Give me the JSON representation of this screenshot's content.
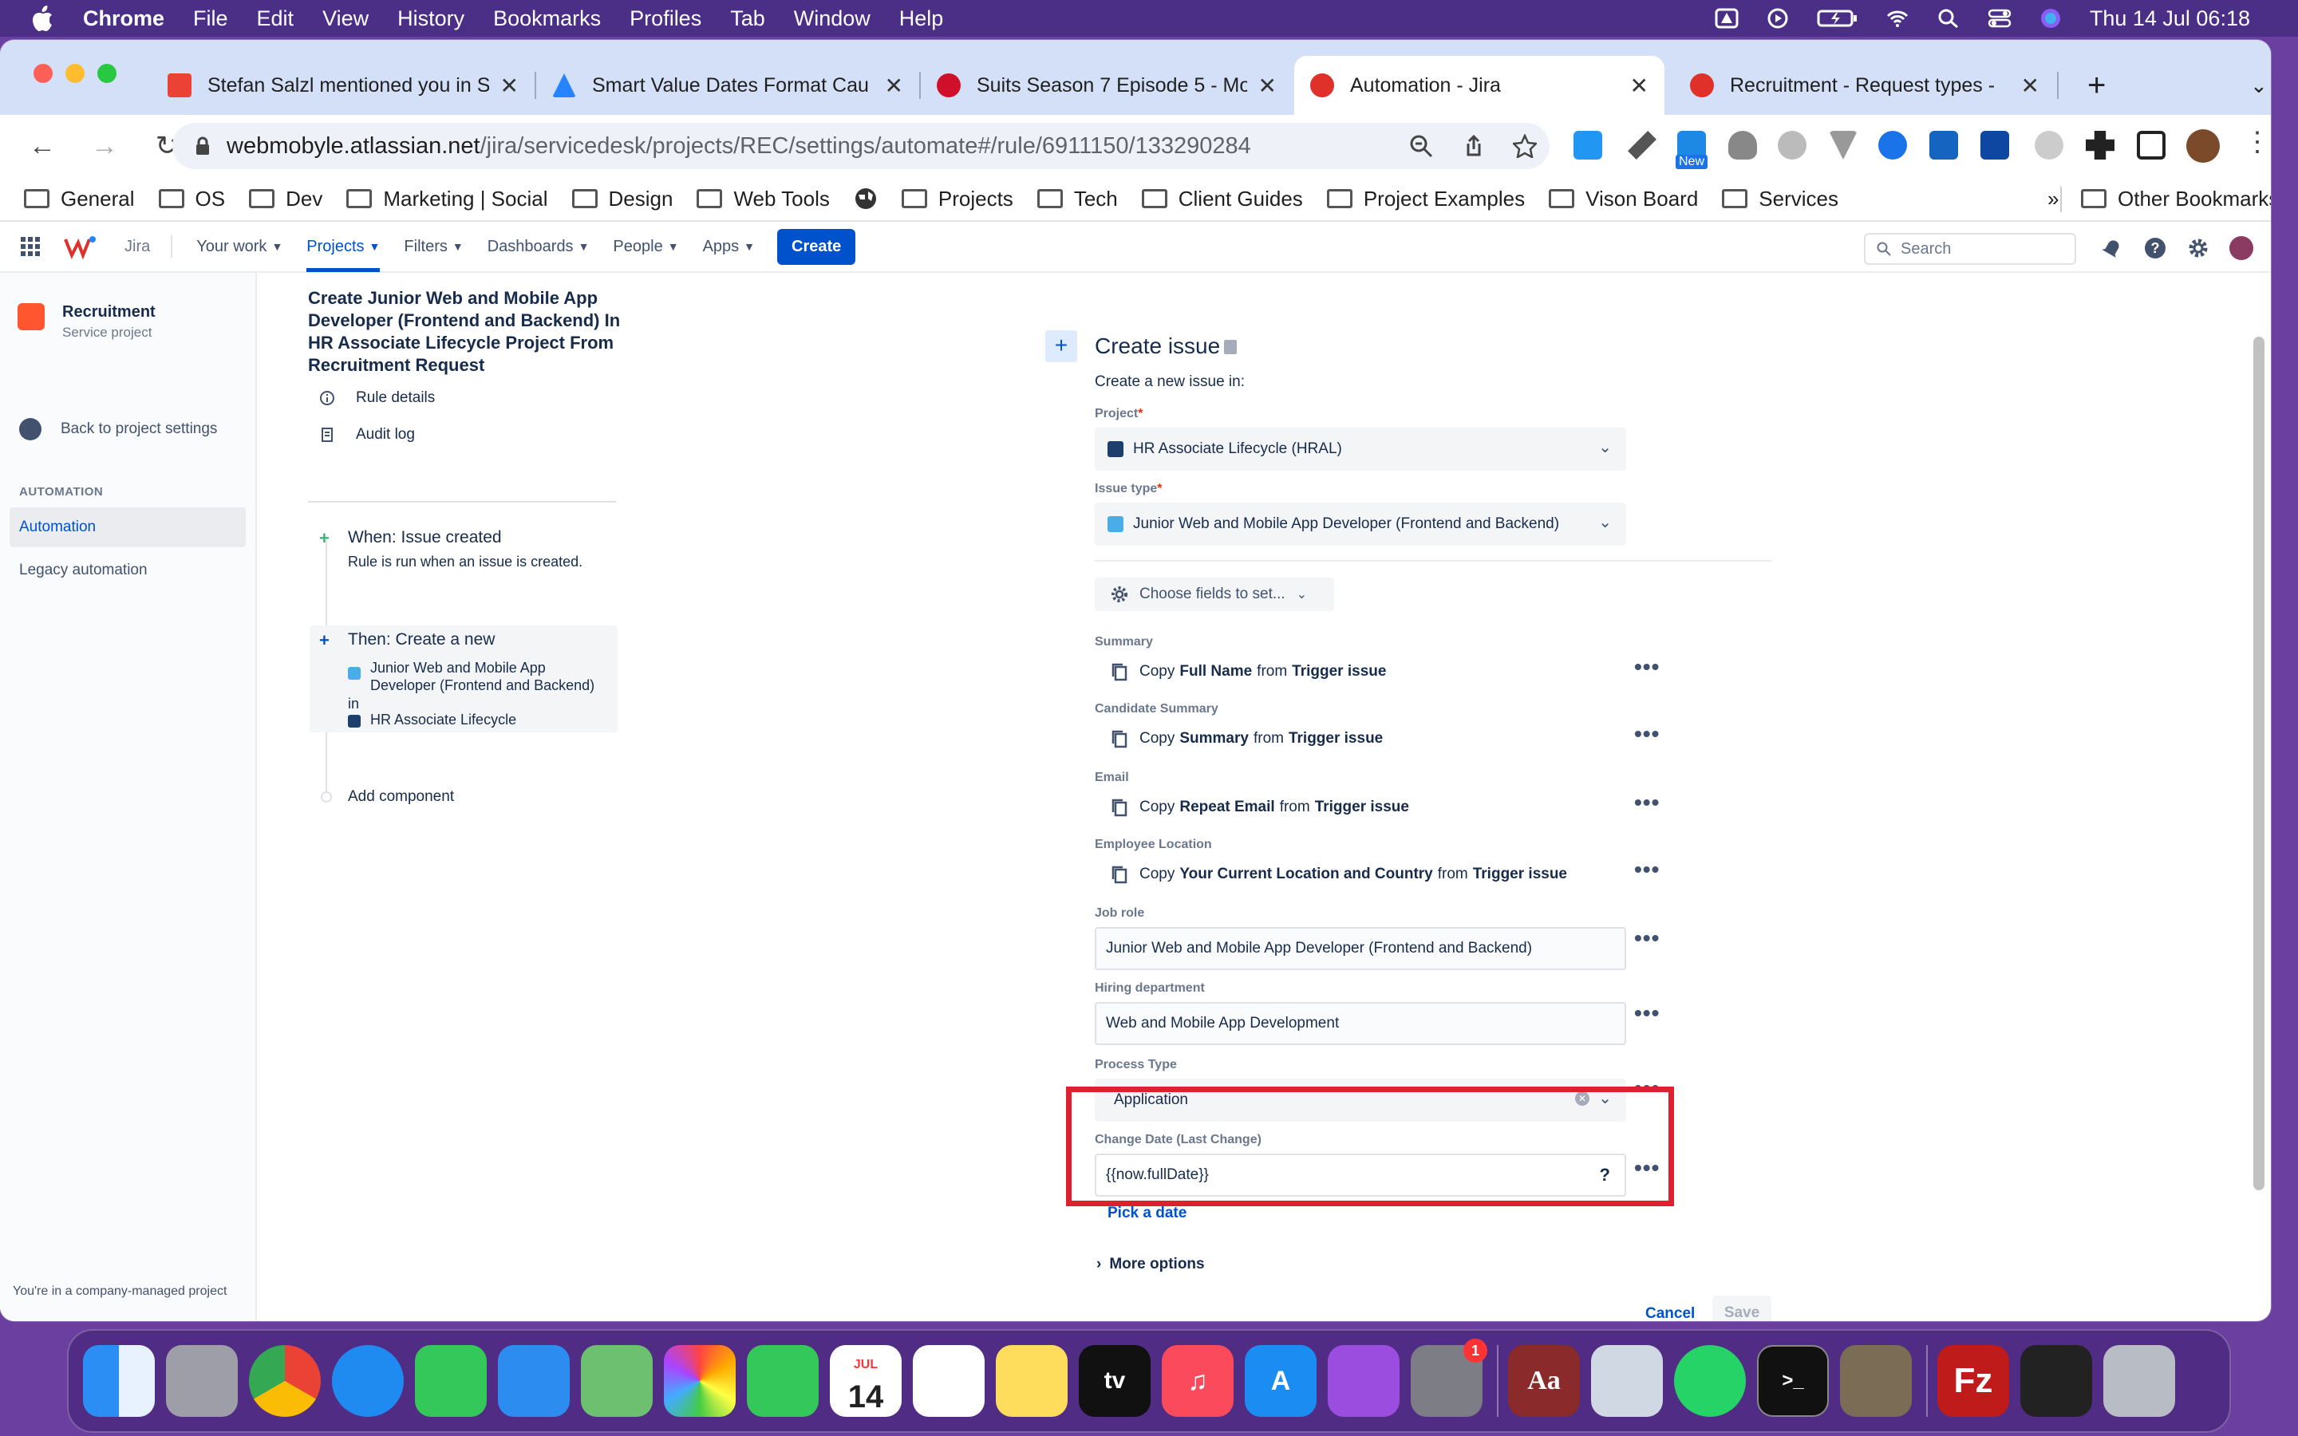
{
  "menubar": {
    "app": "Chrome",
    "menus": [
      "File",
      "Edit",
      "View",
      "History",
      "Bookmarks",
      "Profiles",
      "Tab",
      "Window",
      "Help"
    ],
    "clock": "Thu 14 Jul  06:18"
  },
  "tabs": [
    {
      "title": "Stefan Salzl mentioned you in S",
      "favicon": "gmail-icon",
      "color": "#ea4335"
    },
    {
      "title": "Smart Value Dates Format Cau",
      "favicon": "atlassian-icon",
      "color": "#2684ff"
    },
    {
      "title": "Suits Season 7 Episode 5 - Mo",
      "favicon": "m4u-icon",
      "color": "#d0102a"
    },
    {
      "title": "Automation - Jira",
      "favicon": "jira-icon",
      "color": "#e0302a"
    },
    {
      "title": "Recruitment - Request types -",
      "favicon": "jira-icon",
      "color": "#e0302a"
    }
  ],
  "address": {
    "host": "webmobyle.atlassian.net",
    "path": "/jira/servicedesk/projects/REC/settings/automate#/rule/6911150/133290284"
  },
  "extensions": {
    "new_badge": "New"
  },
  "bookmarks": [
    "General",
    "OS",
    "Dev",
    "Marketing | Social",
    "Design",
    "Web Tools",
    "",
    "Projects",
    "Tech",
    "Client Guides",
    "Project Examples",
    "Vison Board",
    "Services"
  ],
  "bookmarks_overflow": "»",
  "other_bookmarks": "Other Bookmarks",
  "jira": {
    "product": "Jira",
    "nav": [
      "Your work",
      "Projects",
      "Filters",
      "Dashboards",
      "People",
      "Apps"
    ],
    "create": "Create",
    "search_placeholder": "Search"
  },
  "sidebar": {
    "project_name": "Recruitment",
    "project_type": "Service project",
    "back": "Back to project settings",
    "section": "AUTOMATION",
    "items": [
      "Automation",
      "Legacy automation"
    ],
    "footer": "You're in a company-managed project"
  },
  "rule": {
    "title": "Create Junior Web and Mobile App Developer (Frontend and Backend) In HR Associate Lifecycle Project From Recruitment Request",
    "links": [
      "Rule details",
      "Audit log"
    ],
    "trigger_title": "When: Issue created",
    "trigger_desc": "Rule is run when an issue is created.",
    "action_title": "Then: Create a new",
    "action_issue_type": "Junior Web and Mobile App Developer (Frontend and Backend)",
    "action_in": "in",
    "action_project": "HR Associate Lifecycle",
    "add_component": "Add component"
  },
  "form": {
    "title": "Create issue",
    "subtitle": "Create a new issue in:",
    "project_label": "Project",
    "project_value": "HR Associate Lifecycle (HRAL)",
    "issuetype_label": "Issue type",
    "issuetype_value": "Junior Web and Mobile App Developer (Frontend and Backend)",
    "choose_fields": "Choose fields to set...",
    "copy_fields": [
      {
        "label": "Summary",
        "copy": "Copy",
        "field": "Full Name",
        "from": "from",
        "source": "Trigger issue"
      },
      {
        "label": "Candidate Summary",
        "copy": "Copy",
        "field": "Summary",
        "from": "from",
        "source": "Trigger issue"
      },
      {
        "label": "Email",
        "copy": "Copy",
        "field": "Repeat Email",
        "from": "from",
        "source": "Trigger issue"
      },
      {
        "label": "Employee Location",
        "copy": "Copy",
        "field": "Your Current Location and Country",
        "from": "from",
        "source": "Trigger issue"
      }
    ],
    "job_role_label": "Job role",
    "job_role_value": "Junior Web and Mobile App Developer (Frontend and Backend)",
    "hiring_label": "Hiring department",
    "hiring_value": "Web and Mobile App Development",
    "process_label": "Process Type",
    "process_value": "Application",
    "change_date_label": "Change Date (Last Change)",
    "change_date_value": "{{now.fullDate}}",
    "help": "?",
    "pick_date": "Pick a date",
    "more_options": "More options",
    "cancel": "Cancel",
    "save": "Save"
  },
  "dock": {
    "calendar_month": "JUL",
    "calendar_day": "14",
    "settings_badge": "1",
    "tv_label": "tv"
  }
}
